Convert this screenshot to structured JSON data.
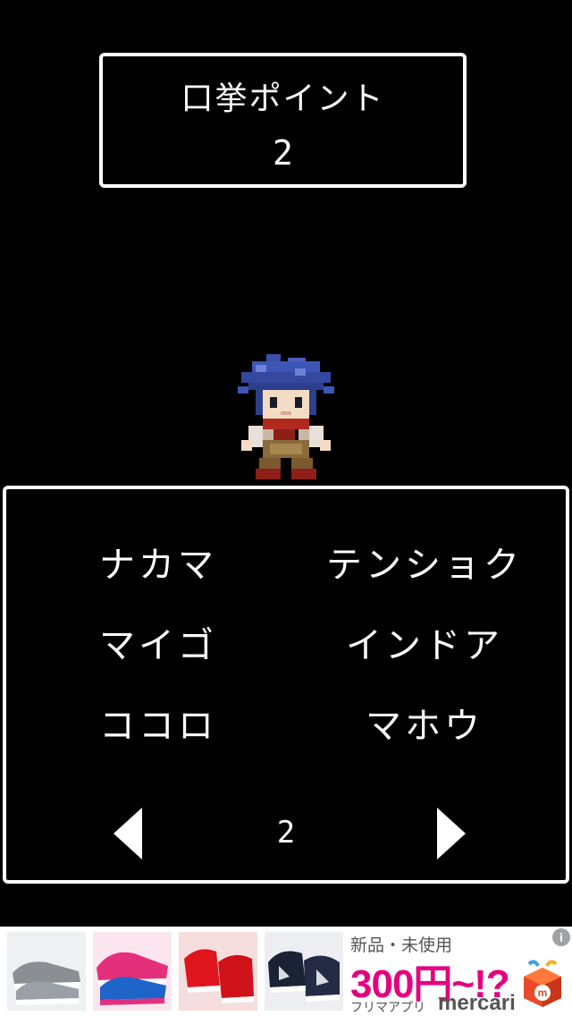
{
  "points_panel": {
    "title": "口挙ポイント",
    "value": "2"
  },
  "menu": {
    "items": [
      {
        "label": "ナカマ"
      },
      {
        "label": "テンショク"
      },
      {
        "label": "マイゴ"
      },
      {
        "label": "インドア"
      },
      {
        "label": "ココロ"
      },
      {
        "label": "マホウ"
      }
    ],
    "page_number": "2"
  },
  "ad": {
    "line1": "新品・未使用",
    "line2": "300円~!?",
    "line3": "フリマアプリ",
    "brand": "mercari",
    "info_icon": "i",
    "colors": {
      "accent": "#e4007f"
    }
  },
  "colors": {
    "background": "#000000",
    "foreground": "#ffffff"
  }
}
